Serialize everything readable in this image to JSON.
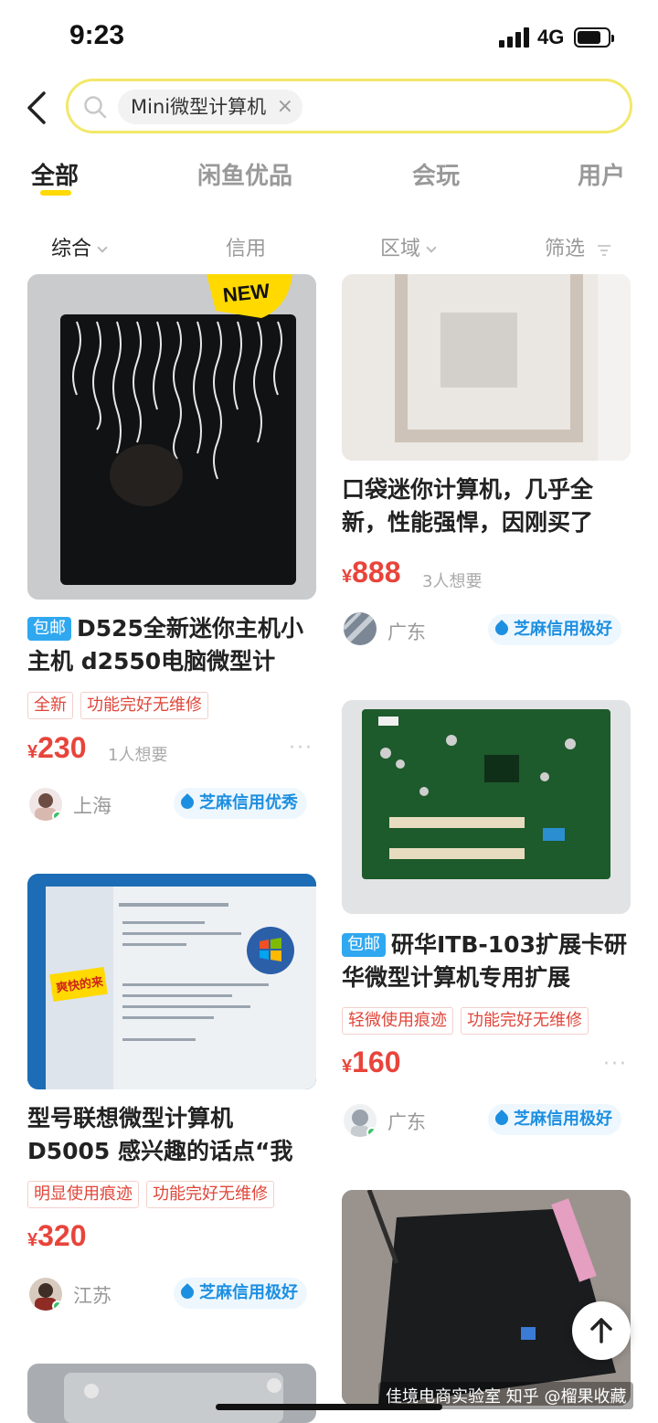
{
  "status": {
    "time": "9:23",
    "network": "4G"
  },
  "search": {
    "query": "Mini微型计算机",
    "clear": "×"
  },
  "tabs": [
    "全部",
    "闲鱼优品",
    "会玩",
    "用户"
  ],
  "filters": [
    "综合",
    "信用",
    "区域",
    "筛选"
  ],
  "cards": [
    {
      "badge": "包邮",
      "title": "D525全新迷你主机小主机 d2550电脑微型计",
      "tags": [
        "全新",
        "功能完好无维修"
      ],
      "yen": "¥",
      "price": "230",
      "wants": "1人想要",
      "location": "上海",
      "credit": "芝麻信用优秀",
      "image_badge": "NEW"
    },
    {
      "badge": "",
      "title": "口袋迷你计算机，几乎全新，性能强悍，因刚买了",
      "tags": [],
      "yen": "¥",
      "price": "888",
      "wants": "3人想要",
      "location": "广东",
      "credit": "芝麻信用极好"
    },
    {
      "badge": "包邮",
      "title": "研华ITB-103扩展卡研华微型计算机专用扩展",
      "tags": [
        "轻微使用痕迹",
        "功能完好无维修"
      ],
      "yen": "¥",
      "price": "160",
      "wants": "",
      "location": "广东",
      "credit": "芝麻信用极好"
    },
    {
      "badge": "",
      "title": "型号联想微型计算机 D5005 感兴趣的话点“我",
      "tags": [
        "明显使用痕迹",
        "功能完好无维修"
      ],
      "yen": "¥",
      "price": "320",
      "wants": "",
      "location": "江苏",
      "credit": "芝麻信用极好",
      "image_sticker": "爽快的来"
    }
  ],
  "more": "···",
  "watermark": "佳境电商实验室 知乎 @榴果收藏",
  "icons": {
    "back": "chevron-left-icon",
    "search": "search-icon",
    "top": "arrow-up-icon",
    "credit": "sesame-drop-icon"
  },
  "colors": {
    "accent": "#ffd900",
    "price": "#e8443b",
    "credit": "#1d8fe0",
    "badge": "#2fa8f0"
  }
}
